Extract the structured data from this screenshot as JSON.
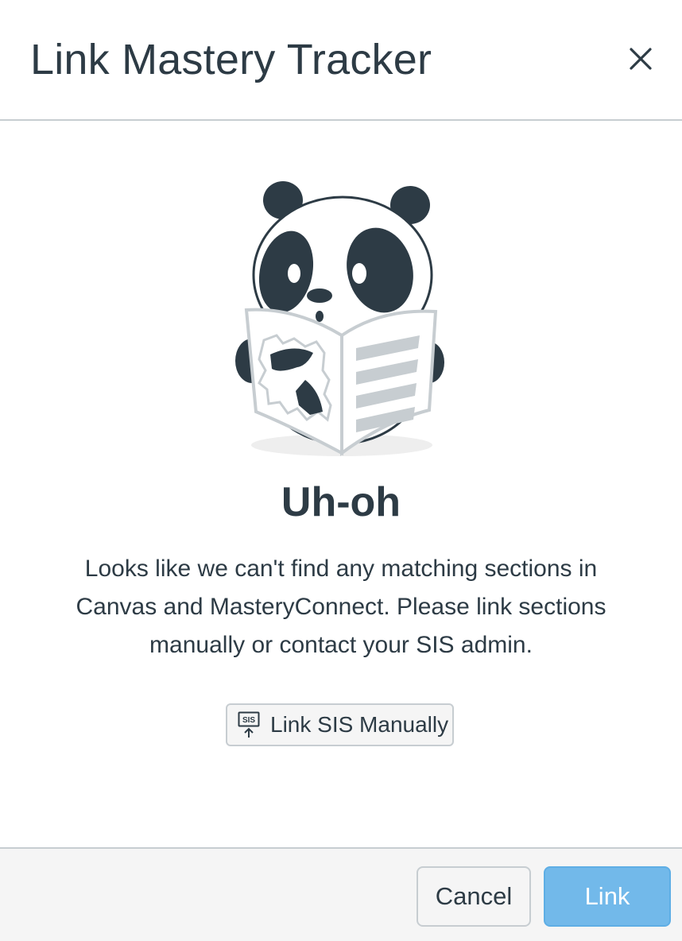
{
  "modal": {
    "title": "Link Mastery Tracker",
    "close_icon": "close-icon"
  },
  "body": {
    "illustration": "panda-reading-newspaper",
    "headline": "Uh-oh",
    "message": "Looks like we can't find any matching sections in Canvas and MasteryConnect. Please link sections manually or contact your SIS admin.",
    "sis_button": {
      "icon": "sis-upload-icon",
      "icon_text": "SIS",
      "label": "Link SIS Manually"
    }
  },
  "footer": {
    "cancel_label": "Cancel",
    "link_label": "Link"
  },
  "colors": {
    "text": "#2d3b45",
    "border": "#c7cdd1",
    "footer_bg": "#f5f5f5",
    "primary_disabled": "#72b9ea",
    "panda_dark": "#2d3b45"
  }
}
